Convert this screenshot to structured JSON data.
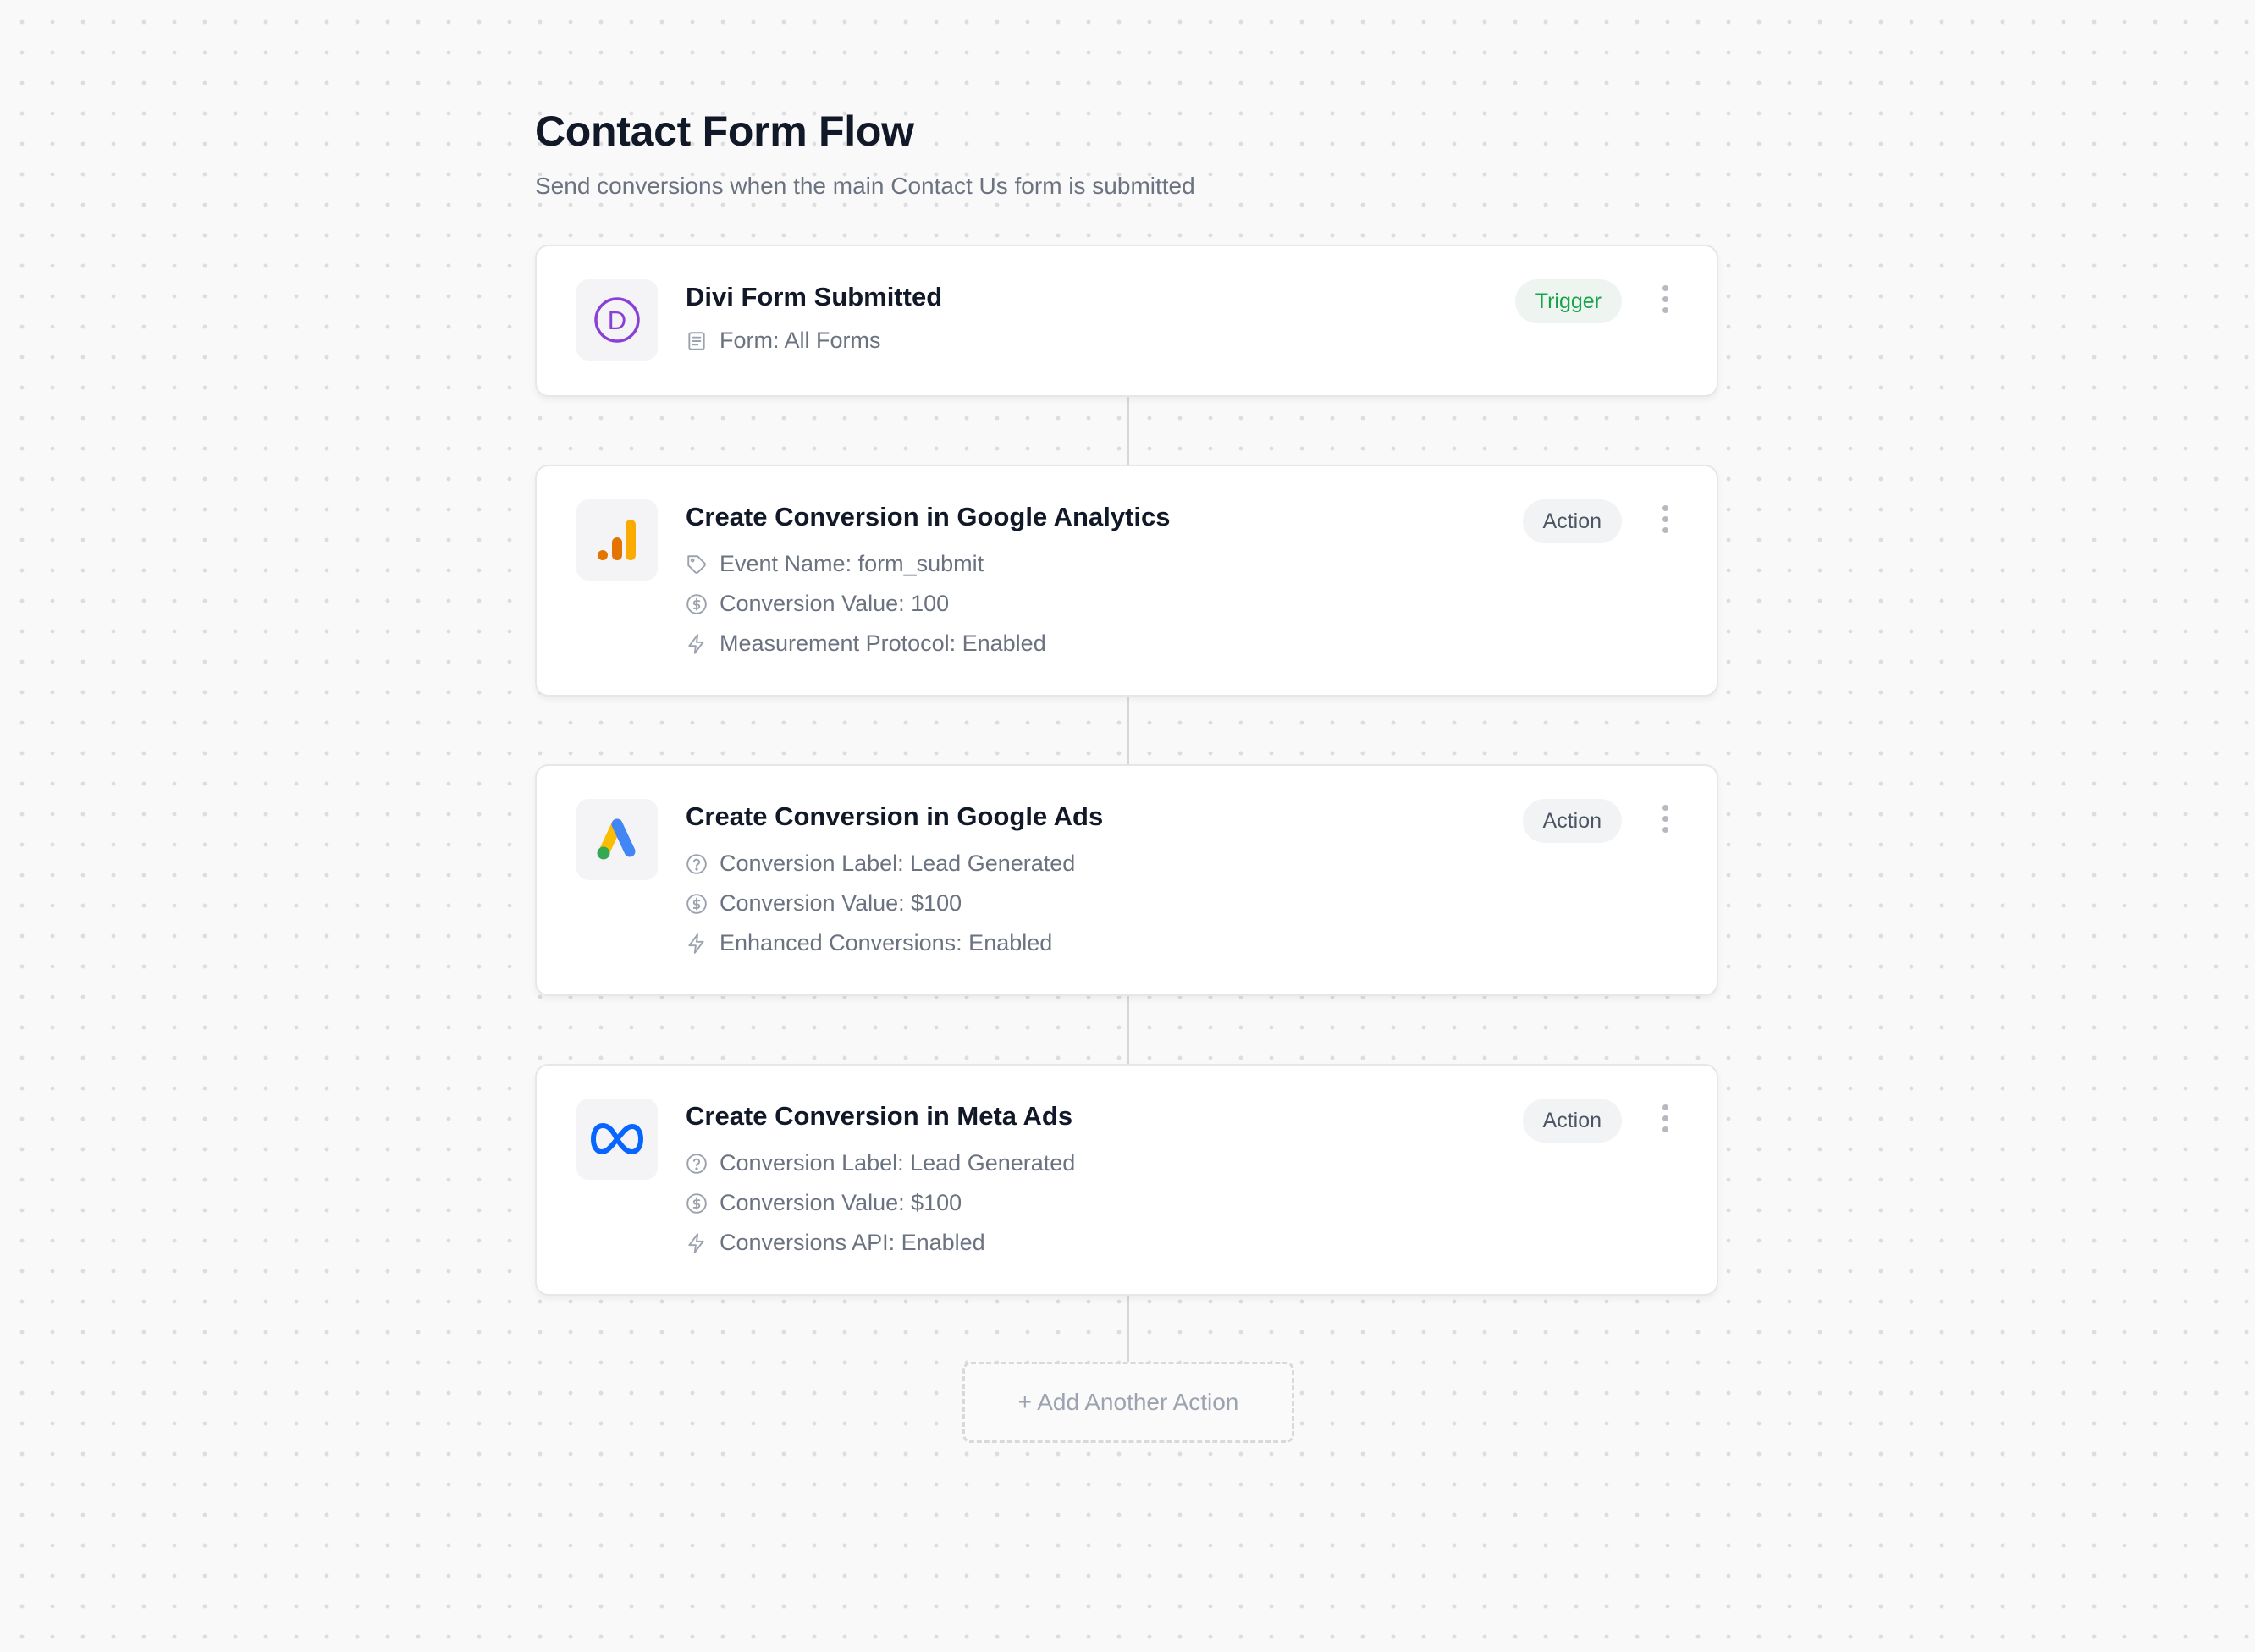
{
  "page": {
    "title": "Contact Form Flow",
    "subtitle": "Send conversions when the main Contact Us form is submitted"
  },
  "trigger": {
    "title": "Divi Form Submitted",
    "badge": "Trigger",
    "logo": "divi-logo",
    "details": [
      {
        "icon": "form-icon",
        "text": "Form: All Forms"
      }
    ]
  },
  "actions": [
    {
      "title": "Create Conversion in Google Analytics",
      "badge": "Action",
      "logo": "google-analytics-logo",
      "details": [
        {
          "icon": "tag-icon",
          "text": "Event Name: form_submit"
        },
        {
          "icon": "dollar-icon",
          "text": "Conversion Value: 100"
        },
        {
          "icon": "bolt-icon",
          "text": "Measurement Protocol: Enabled"
        }
      ]
    },
    {
      "title": "Create Conversion in Google Ads",
      "badge": "Action",
      "logo": "google-ads-logo",
      "details": [
        {
          "icon": "help-circle-icon",
          "text": "Conversion Label: Lead Generated"
        },
        {
          "icon": "dollar-icon",
          "text": "Conversion Value: $100"
        },
        {
          "icon": "bolt-icon",
          "text": "Enhanced Conversions: Enabled"
        }
      ]
    },
    {
      "title": "Create Conversion in Meta Ads",
      "badge": "Action",
      "logo": "meta-logo",
      "details": [
        {
          "icon": "help-circle-icon",
          "text": "Conversion Label: Lead Generated"
        },
        {
          "icon": "dollar-icon",
          "text": "Conversion Value: $100"
        },
        {
          "icon": "bolt-icon",
          "text": "Conversions API: Enabled"
        }
      ]
    }
  ],
  "add_action": {
    "label": "+ Add Another Action"
  },
  "colors": {
    "trigger_badge": "#16a34a",
    "divi": "#8b3fd9",
    "google_analytics_orange": "#e37400",
    "google_analytics_yellow": "#f9ab00",
    "google_ads_blue": "#4285f4",
    "google_ads_yellow": "#fbbc04",
    "google_ads_green": "#34a853",
    "meta_blue": "#0866ff"
  }
}
